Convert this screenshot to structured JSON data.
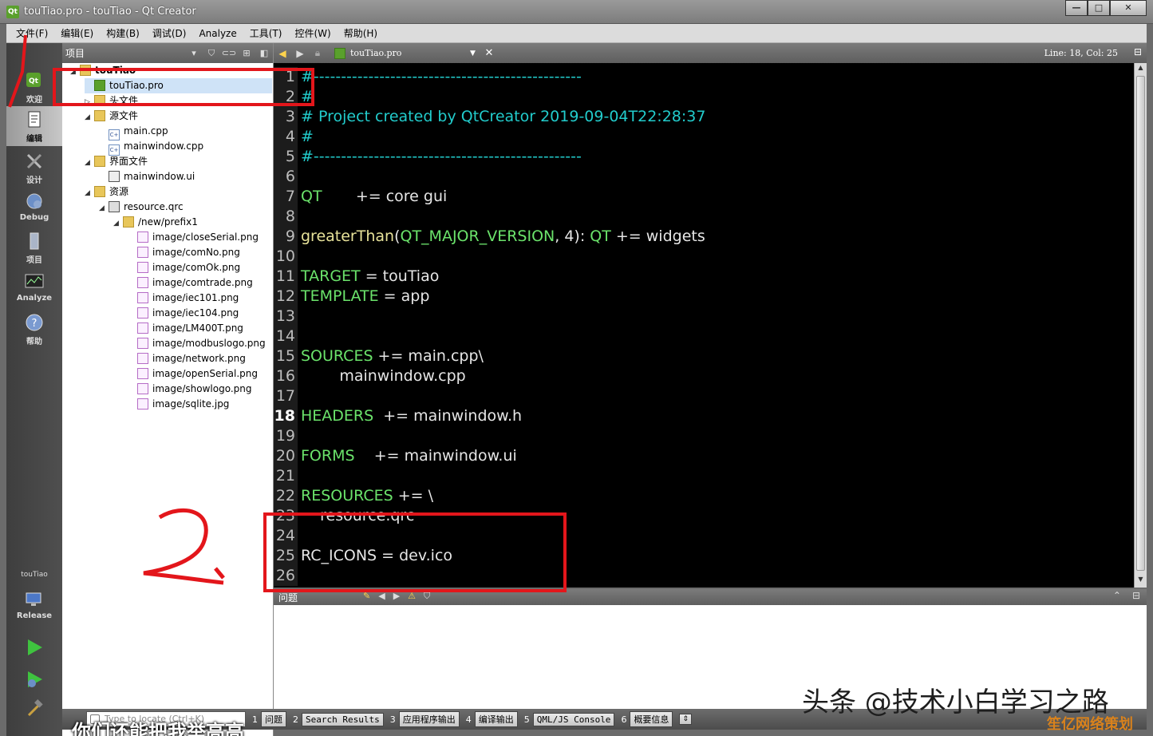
{
  "window": {
    "title": "touTiao.pro - touTiao - Qt Creator",
    "app_icon": "Qt",
    "minimize": "—",
    "maximize": "□",
    "close": "✕"
  },
  "menu": [
    "文件(F)",
    "编辑(E)",
    "构建(B)",
    "调试(D)",
    "Analyze",
    "工具(T)",
    "控件(W)",
    "帮助(H)"
  ],
  "modes": [
    {
      "label": "欢迎",
      "icon": "qt-welcome-icon"
    },
    {
      "label": "编辑",
      "icon": "edit-document-icon",
      "active": true
    },
    {
      "label": "设计",
      "icon": "design-tools-icon"
    },
    {
      "label": "Debug",
      "icon": "debug-bug-icon"
    },
    {
      "label": "项目",
      "icon": "project-file-icon"
    },
    {
      "label": "Analyze",
      "icon": "analyze-monitor-icon"
    },
    {
      "label": "帮助",
      "icon": "help-question-icon"
    }
  ],
  "kit": {
    "project": "touTiao",
    "build": "Release"
  },
  "project_panel": {
    "title": "项目",
    "tree": [
      {
        "label": "touTiao",
        "depth": 0,
        "type": "pro-root",
        "expanded": true
      },
      {
        "label": "touTiao.pro",
        "depth": 1,
        "type": "pro",
        "selected": true
      },
      {
        "label": "头文件",
        "depth": 1,
        "type": "folder",
        "collapsed": true
      },
      {
        "label": "源文件",
        "depth": 1,
        "type": "folder",
        "expanded": true
      },
      {
        "label": "main.cpp",
        "depth": 2,
        "type": "cpp"
      },
      {
        "label": "mainwindow.cpp",
        "depth": 2,
        "type": "cpp"
      },
      {
        "label": "界面文件",
        "depth": 1,
        "type": "folder",
        "expanded": true
      },
      {
        "label": "mainwindow.ui",
        "depth": 2,
        "type": "ui"
      },
      {
        "label": "资源",
        "depth": 1,
        "type": "folder",
        "expanded": true
      },
      {
        "label": "resource.qrc",
        "depth": 2,
        "type": "qrc",
        "expanded": true
      },
      {
        "label": "/new/prefix1",
        "depth": 3,
        "type": "folder",
        "expanded": true
      },
      {
        "label": "image/closeSerial.png",
        "depth": 4,
        "type": "img"
      },
      {
        "label": "image/comNo.png",
        "depth": 4,
        "type": "img"
      },
      {
        "label": "image/comOk.png",
        "depth": 4,
        "type": "img"
      },
      {
        "label": "image/comtrade.png",
        "depth": 4,
        "type": "img"
      },
      {
        "label": "image/iec101.png",
        "depth": 4,
        "type": "img"
      },
      {
        "label": "image/iec104.png",
        "depth": 4,
        "type": "img"
      },
      {
        "label": "image/LM400T.png",
        "depth": 4,
        "type": "img"
      },
      {
        "label": "image/modbuslogo.png",
        "depth": 4,
        "type": "img"
      },
      {
        "label": "image/network.png",
        "depth": 4,
        "type": "img"
      },
      {
        "label": "image/openSerial.png",
        "depth": 4,
        "type": "img"
      },
      {
        "label": "image/showlogo.png",
        "depth": 4,
        "type": "img"
      },
      {
        "label": "image/sqlite.jpg",
        "depth": 4,
        "type": "img"
      }
    ]
  },
  "editor": {
    "file": "touTiao.pro",
    "position": "Line: 18, Col: 25",
    "current_line": 18,
    "lines": [
      [
        {
          "c": "cm",
          "t": "#-------------------------------------------------"
        }
      ],
      [
        {
          "c": "cm",
          "t": "#"
        }
      ],
      [
        {
          "c": "cm",
          "t": "# Project created by QtCreator 2019-09-04T22:28:37"
        }
      ],
      [
        {
          "c": "cm",
          "t": "#"
        }
      ],
      [
        {
          "c": "cm",
          "t": "#-------------------------------------------------"
        }
      ],
      [],
      [
        {
          "c": "kw",
          "t": "QT"
        },
        {
          "c": "tx",
          "t": "       += core gui"
        }
      ],
      [],
      [
        {
          "c": "fn",
          "t": "greaterThan"
        },
        {
          "c": "tx",
          "t": "("
        },
        {
          "c": "kw",
          "t": "QT_MAJOR_VERSION"
        },
        {
          "c": "tx",
          "t": ", 4): "
        },
        {
          "c": "kw",
          "t": "QT"
        },
        {
          "c": "tx",
          "t": " += widgets"
        }
      ],
      [],
      [
        {
          "c": "kw",
          "t": "TARGET"
        },
        {
          "c": "tx",
          "t": " = touTiao"
        }
      ],
      [
        {
          "c": "kw",
          "t": "TEMPLATE"
        },
        {
          "c": "tx",
          "t": " = app"
        }
      ],
      [],
      [],
      [
        {
          "c": "kw",
          "t": "SOURCES"
        },
        {
          "c": "tx",
          "t": " += main.cpp\\"
        }
      ],
      [
        {
          "c": "tx",
          "t": "        mainwindow.cpp"
        }
      ],
      [],
      [
        {
          "c": "kw",
          "t": "HEADERS"
        },
        {
          "c": "tx",
          "t": "  += mainwindow.h"
        }
      ],
      [],
      [
        {
          "c": "kw",
          "t": "FORMS"
        },
        {
          "c": "tx",
          "t": "    += mainwindow.ui"
        }
      ],
      [],
      [
        {
          "c": "kw",
          "t": "RESOURCES"
        },
        {
          "c": "tx",
          "t": " += \\"
        }
      ],
      [
        {
          "c": "tx",
          "t": "    resource.qrc"
        }
      ],
      [],
      [
        {
          "c": "tx",
          "t": "RC_ICONS = dev.ico"
        }
      ],
      []
    ]
  },
  "issues": {
    "title": "问题"
  },
  "bottom": {
    "locate_placeholder": "Type to locate (Ctrl+K)",
    "tabs": [
      {
        "num": "1",
        "label": "问题"
      },
      {
        "num": "2",
        "label": "Search Results"
      },
      {
        "num": "3",
        "label": "应用程序输出"
      },
      {
        "num": "4",
        "label": "编译输出"
      },
      {
        "num": "5",
        "label": "QML/JS Console"
      },
      {
        "num": "6",
        "label": "概要信息"
      }
    ]
  },
  "annotations": {
    "mark_1": "1",
    "mark_2": "2",
    "color": "#e3161b",
    "watermark": "头条 @技术小白学习之路",
    "corner_watermark": "笙亿网络策划",
    "subtitle": "你们还能把我举高高"
  }
}
